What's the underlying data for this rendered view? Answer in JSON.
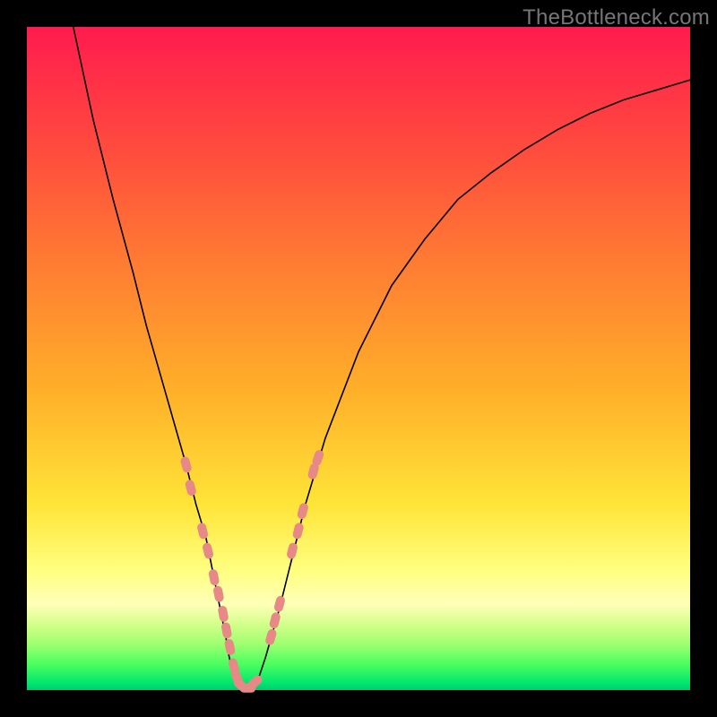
{
  "watermark": "TheBottleneck.com",
  "colors": {
    "frame": "#000000",
    "curve_stroke": "#000000",
    "marker_fill": "#e78a87",
    "gradient_top": "#ff1b4e",
    "gradient_bottom": "#00c878"
  },
  "chart_data": {
    "type": "line",
    "title": "",
    "xlabel": "",
    "ylabel": "",
    "xlim": [
      0,
      100
    ],
    "ylim": [
      0,
      100
    ],
    "grid": false,
    "legend": false,
    "note": "No axis ticks or value labels are visible in the image; x,y are percentages of the visible plot area with y=0 at bottom. Values are read from pixel positions.",
    "series": [
      {
        "name": "curve",
        "x": [
          7,
          10,
          13,
          16,
          18,
          20,
          22,
          24,
          25.5,
          27,
          28,
          29,
          30,
          30.5,
          31,
          31.5,
          32,
          33,
          34,
          35,
          36,
          38,
          40,
          42,
          45,
          50,
          55,
          60,
          65,
          70,
          75,
          80,
          85,
          90,
          95,
          100
        ],
        "y": [
          100,
          86,
          74,
          63,
          55,
          48,
          41,
          34,
          28,
          23,
          18,
          13,
          8,
          5,
          3,
          1.5,
          0.5,
          0.2,
          0.5,
          2,
          5,
          12,
          20,
          28,
          38,
          51,
          61,
          68,
          74,
          78,
          81.5,
          84.5,
          87,
          89,
          90.5,
          92
        ],
        "note": "Single continuous V-shaped curve; minimum near x≈33, y≈0."
      }
    ],
    "markers": {
      "name": "highlighted-points",
      "shape": "rounded-capsule",
      "approx_color": "#e78a87",
      "points": [
        {
          "x": 24.0,
          "y": 34.0
        },
        {
          "x": 24.7,
          "y": 30.5
        },
        {
          "x": 26.5,
          "y": 24.0
        },
        {
          "x": 27.3,
          "y": 21.0
        },
        {
          "x": 28.2,
          "y": 17.0
        },
        {
          "x": 28.9,
          "y": 14.5
        },
        {
          "x": 29.6,
          "y": 11.5
        },
        {
          "x": 30.1,
          "y": 9.0
        },
        {
          "x": 30.6,
          "y": 6.5
        },
        {
          "x": 31.2,
          "y": 3.6
        },
        {
          "x": 31.7,
          "y": 1.8
        },
        {
          "x": 32.3,
          "y": 0.7
        },
        {
          "x": 33.3,
          "y": 0.3
        },
        {
          "x": 34.4,
          "y": 1.2
        },
        {
          "x": 36.8,
          "y": 8.0
        },
        {
          "x": 37.4,
          "y": 10.5
        },
        {
          "x": 38.1,
          "y": 13.0
        },
        {
          "x": 40.0,
          "y": 21.0
        },
        {
          "x": 40.9,
          "y": 24.0
        },
        {
          "x": 41.6,
          "y": 27.0
        },
        {
          "x": 43.2,
          "y": 33.0
        },
        {
          "x": 43.9,
          "y": 35.0
        }
      ]
    }
  }
}
